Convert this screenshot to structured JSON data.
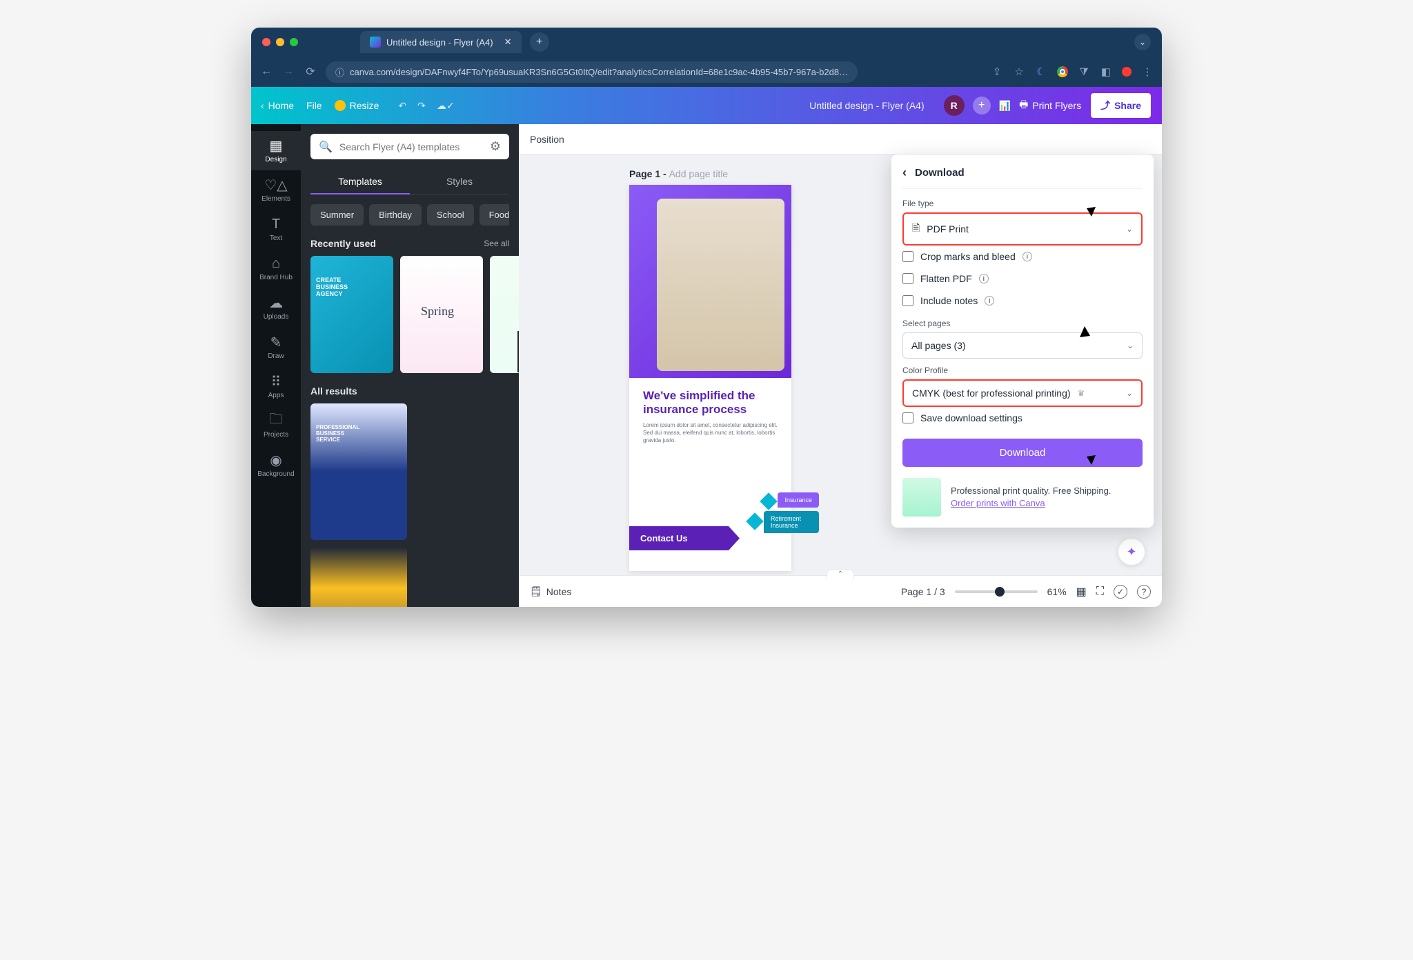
{
  "browser": {
    "tab_title": "Untitled design - Flyer (A4)",
    "url": "canva.com/design/DAFnwyf4FTo/Yp69usuaKR3Sn6G5Gt0ItQ/edit?analyticsCorrelationId=68e1c9ac-4b95-45b7-967a-b2d8…"
  },
  "toolbar": {
    "home": "Home",
    "file": "File",
    "resize": "Resize",
    "doc_title": "Untitled design - Flyer (A4)",
    "avatar_initial": "R",
    "print_btn": "Print Flyers",
    "share_btn": "Share"
  },
  "rail": {
    "items": [
      {
        "label": "Design"
      },
      {
        "label": "Elements"
      },
      {
        "label": "Text"
      },
      {
        "label": "Brand Hub"
      },
      {
        "label": "Uploads"
      },
      {
        "label": "Draw"
      },
      {
        "label": "Apps"
      },
      {
        "label": "Projects"
      },
      {
        "label": "Background"
      }
    ]
  },
  "panel": {
    "search_placeholder": "Search Flyer (A4) templates",
    "tab_templates": "Templates",
    "tab_styles": "Styles",
    "chips": [
      "Summer",
      "Birthday",
      "School",
      "Food"
    ],
    "recent_label": "Recently used",
    "see_all": "See all",
    "all_label": "All results"
  },
  "canvas": {
    "position": "Position",
    "page_prefix": "Page 1 - ",
    "page_placeholder": "Add page title",
    "headline": "We've simplified the insurance process",
    "body": "Lorem ipsum dolor sit amet, consectetur adipiscing elit. Sed dui massa, eleifend quis nunc at, lobortis, lobortis gravida justo.",
    "contact": "Contact Us",
    "badge1": "Insurance",
    "badge2": "Retirement Insurance"
  },
  "download": {
    "title": "Download",
    "file_type_label": "File type",
    "file_type_value": "PDF Print",
    "crop_marks": "Crop marks and bleed",
    "flatten": "Flatten PDF",
    "include_notes": "Include notes",
    "select_pages_label": "Select pages",
    "select_pages_value": "All pages (3)",
    "color_profile_label": "Color Profile",
    "color_profile_value": "CMYK (best for professional printing)",
    "save_settings": "Save download settings",
    "download_btn": "Download",
    "promo_text": "Professional print quality. Free Shipping.",
    "promo_link": "Order prints with Canva"
  },
  "bottom": {
    "notes": "Notes",
    "page_info": "Page 1 / 3",
    "zoom": "61%"
  }
}
